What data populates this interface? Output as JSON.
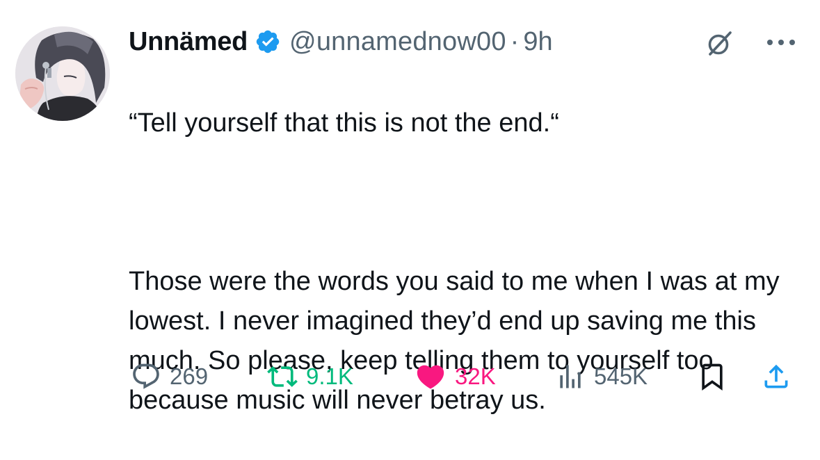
{
  "author": {
    "display_name": "Unnämed",
    "handle": "@unnamednow00",
    "separator": "·",
    "time": "9h",
    "verified": true,
    "avatar_icon": "anime-avatar"
  },
  "header_icons": {
    "grok": "grok-icon",
    "more": "more-icon"
  },
  "tweet": {
    "quote_line": "“Tell yourself that this is not the end.“",
    "body": "Those were the words you said to me when I was at my lowest. I never imagined they’d end up saving me this much. So please, keep telling them to yourself too because music will never betray us."
  },
  "actions": {
    "replies": "269",
    "retweets": "9.1K",
    "likes": "32K",
    "views": "545K",
    "liked": true
  },
  "colors": {
    "text": "#0f1419",
    "secondary": "#536471",
    "verified": "#1d9bf0",
    "retweet": "#00ba7c",
    "like": "#f91880"
  }
}
